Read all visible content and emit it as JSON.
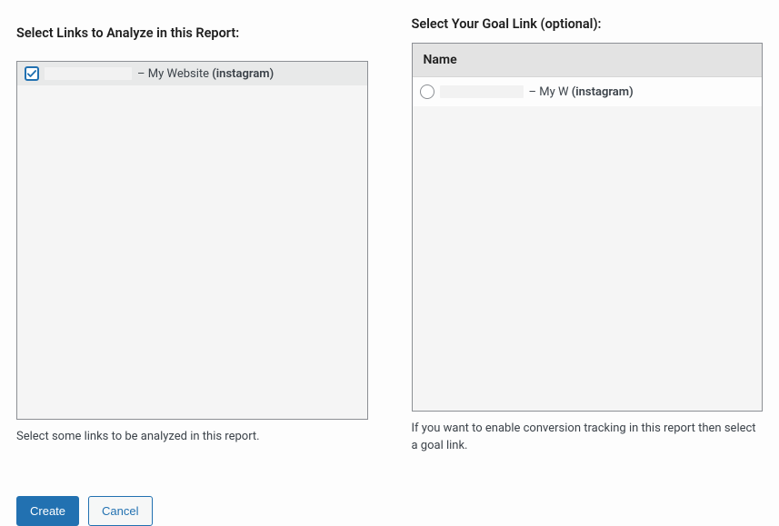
{
  "left": {
    "heading": "Select Links to Analyze in this Report:",
    "row": {
      "separator": "–",
      "name": "My Website",
      "source": "(instagram)"
    },
    "helper": "Select some links to be analyzed in this report."
  },
  "right": {
    "heading": "Select Your Goal Link (optional):",
    "header_label": "Name",
    "row": {
      "separator": "–",
      "name": "My W",
      "source": "(instagram)"
    },
    "helper": "If you want to enable conversion tracking in this report then select a goal link."
  },
  "actions": {
    "create": "Create",
    "cancel": "Cancel"
  }
}
